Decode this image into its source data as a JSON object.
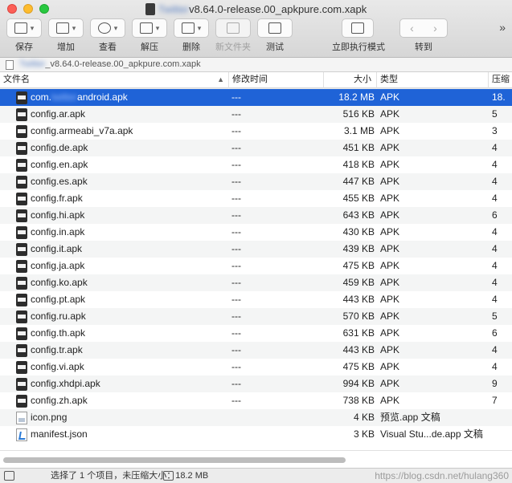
{
  "window": {
    "title_blurred": "Twitter",
    "title_rest": "v8.64.0-release.00_apkpure.com.xapk"
  },
  "toolbar": {
    "buttons": [
      {
        "label": "保存",
        "icon": "save-icon"
      },
      {
        "label": "增加",
        "icon": "add-icon"
      },
      {
        "label": "查看",
        "icon": "view-icon"
      },
      {
        "label": "解压",
        "icon": "extract-icon"
      },
      {
        "label": "删除",
        "icon": "delete-icon"
      },
      {
        "label": "新文件夹",
        "icon": "new-folder-icon"
      },
      {
        "label": "测试",
        "icon": "test-icon"
      },
      {
        "label": "立即执行模式",
        "icon": "run-mode-icon"
      },
      {
        "label": "转到",
        "icon": "goto-icon"
      }
    ],
    "more": "»"
  },
  "pathbar": {
    "blurred": "Twitter",
    "rest": "_v8.64.0-release.00_apkpure.com.xapk"
  },
  "columns": {
    "name": "文件名",
    "modified": "修改时间",
    "size": "大小",
    "type": "类型",
    "compressed": "压缩"
  },
  "files": [
    {
      "name_pre": "com.",
      "name_blur": "twitter",
      "name_post": "android.apk",
      "modified": "---",
      "size": "18.2 MB",
      "type": "APK",
      "compressed": "18.",
      "icon": "apk",
      "selected": true
    },
    {
      "name": "config.ar.apk",
      "modified": "---",
      "size": "516 KB",
      "type": "APK",
      "compressed": "5",
      "icon": "apk"
    },
    {
      "name": "config.armeabi_v7a.apk",
      "modified": "---",
      "size": "3.1 MB",
      "type": "APK",
      "compressed": "3",
      "icon": "apk"
    },
    {
      "name": "config.de.apk",
      "modified": "---",
      "size": "451 KB",
      "type": "APK",
      "compressed": "4",
      "icon": "apk"
    },
    {
      "name": "config.en.apk",
      "modified": "---",
      "size": "418 KB",
      "type": "APK",
      "compressed": "4",
      "icon": "apk"
    },
    {
      "name": "config.es.apk",
      "modified": "---",
      "size": "447 KB",
      "type": "APK",
      "compressed": "4",
      "icon": "apk"
    },
    {
      "name": "config.fr.apk",
      "modified": "---",
      "size": "455 KB",
      "type": "APK",
      "compressed": "4",
      "icon": "apk"
    },
    {
      "name": "config.hi.apk",
      "modified": "---",
      "size": "643 KB",
      "type": "APK",
      "compressed": "6",
      "icon": "apk"
    },
    {
      "name": "config.in.apk",
      "modified": "---",
      "size": "430 KB",
      "type": "APK",
      "compressed": "4",
      "icon": "apk"
    },
    {
      "name": "config.it.apk",
      "modified": "---",
      "size": "439 KB",
      "type": "APK",
      "compressed": "4",
      "icon": "apk"
    },
    {
      "name": "config.ja.apk",
      "modified": "---",
      "size": "475 KB",
      "type": "APK",
      "compressed": "4",
      "icon": "apk"
    },
    {
      "name": "config.ko.apk",
      "modified": "---",
      "size": "459 KB",
      "type": "APK",
      "compressed": "4",
      "icon": "apk"
    },
    {
      "name": "config.pt.apk",
      "modified": "---",
      "size": "443 KB",
      "type": "APK",
      "compressed": "4",
      "icon": "apk"
    },
    {
      "name": "config.ru.apk",
      "modified": "---",
      "size": "570 KB",
      "type": "APK",
      "compressed": "5",
      "icon": "apk"
    },
    {
      "name": "config.th.apk",
      "modified": "---",
      "size": "631 KB",
      "type": "APK",
      "compressed": "6",
      "icon": "apk"
    },
    {
      "name": "config.tr.apk",
      "modified": "---",
      "size": "443 KB",
      "type": "APK",
      "compressed": "4",
      "icon": "apk"
    },
    {
      "name": "config.vi.apk",
      "modified": "---",
      "size": "475 KB",
      "type": "APK",
      "compressed": "4",
      "icon": "apk"
    },
    {
      "name": "config.xhdpi.apk",
      "modified": "---",
      "size": "994 KB",
      "type": "APK",
      "compressed": "9",
      "icon": "apk"
    },
    {
      "name": "config.zh.apk",
      "modified": "---",
      "size": "738 KB",
      "type": "APK",
      "compressed": "7",
      "icon": "apk"
    },
    {
      "name": "icon.png",
      "modified": "",
      "size": "4 KB",
      "type": "预览.app 文稿",
      "compressed": "",
      "icon": "png"
    },
    {
      "name": "manifest.json",
      "modified": "",
      "size": "3 KB",
      "type": "Visual Stu...de.app 文稿",
      "compressed": "",
      "icon": "json"
    }
  ],
  "status": {
    "text": "选择了 1 个项目，未压缩大小：18.2 MB",
    "watermark": "https://blog.csdn.net/hulang360"
  },
  "colors": {
    "selection": "#1f63d7",
    "row_alt": "#f4f5f5"
  }
}
